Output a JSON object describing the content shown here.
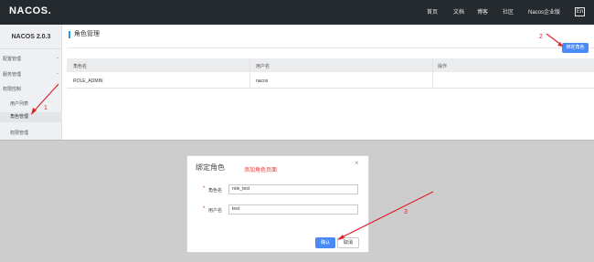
{
  "header": {
    "logo": "NACOS.",
    "nav": [
      "首页",
      "文档",
      "博客",
      "社区",
      "Nacos企业版"
    ],
    "lang": "En"
  },
  "sidebar": {
    "version": "NACOS 2.0.3",
    "groups": [
      "配置管理",
      "服务管理",
      "权限控制"
    ],
    "subitems": [
      "用户列表",
      "角色管理",
      "权限管理"
    ],
    "active": "角色管理"
  },
  "page": {
    "title": "角色管理",
    "bind_button": "绑定角色",
    "table": {
      "headers": [
        "角色名",
        "用户名",
        "操作"
      ],
      "rows": [
        [
          "ROLE_ADMIN",
          "nacos",
          ""
        ]
      ]
    }
  },
  "annotations": {
    "a1": "1",
    "a2": "2",
    "a3": "3",
    "arrow_color": "#d9262b"
  },
  "dialog": {
    "title": "绑定角色",
    "note": "添加角色页面",
    "close": "×",
    "required": "*",
    "fields": [
      {
        "label": "角色名",
        "value": "role_test"
      },
      {
        "label": "用户名",
        "value": "test"
      }
    ],
    "ok": "确认",
    "cancel": "取消"
  },
  "colors": {
    "topbar": "#252a2f",
    "primary_button": "#4a8af4",
    "annotation_red": "#d9262b",
    "overlay": "#cdcdcd"
  }
}
